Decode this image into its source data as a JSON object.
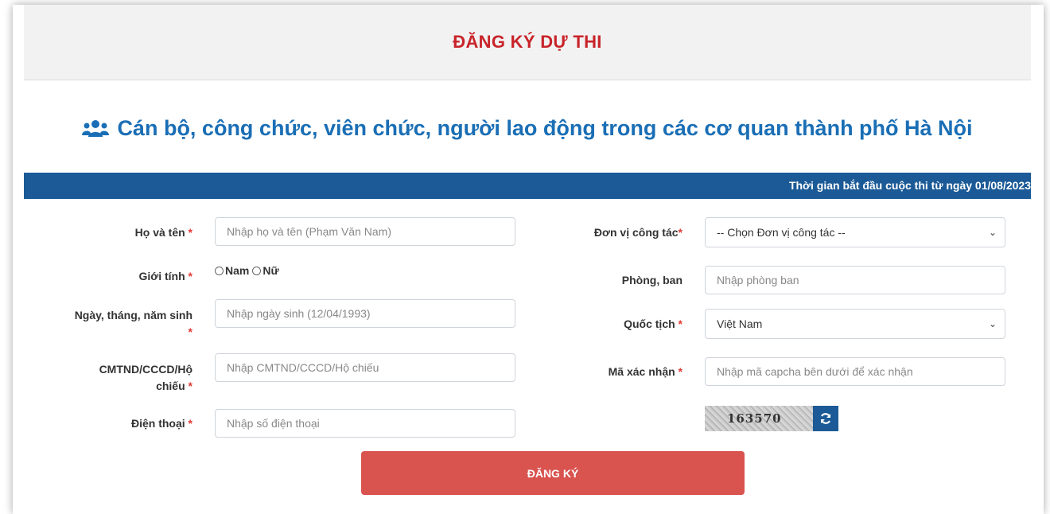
{
  "header": {
    "title": "ĐĂNG KÝ DỰ THI"
  },
  "subtitle": {
    "text": "Cán bộ, công chức, viên chức, người lao động trong các cơ quan thành phố Hà Nội",
    "icon": "users-icon"
  },
  "banner": {
    "text": "Thời gian bắt đầu cuộc thi từ ngày 01/08/2023"
  },
  "left": {
    "name": {
      "label": "Họ và tên",
      "placeholder": "Nhập họ và tên (Phạm Văn Nam)"
    },
    "gender": {
      "label": "Giới tính",
      "options": [
        "Nam",
        "Nữ"
      ]
    },
    "dob": {
      "label": "Ngày, tháng, năm sinh",
      "placeholder": "Nhập ngày sinh (12/04/1993)"
    },
    "id": {
      "label_line1": "CMTND/CCCD/Hộ",
      "label_line2": "chiếu",
      "placeholder": "Nhập CMTND/CCCD/Hộ chiếu"
    },
    "phone": {
      "label": "Điện thoại",
      "placeholder": "Nhập số điện thoại"
    }
  },
  "right": {
    "unit": {
      "label": "Đơn vị công tác",
      "value": "-- Chọn Đơn vị công tác --"
    },
    "dept": {
      "label": "Phòng, ban",
      "placeholder": "Nhập phòng ban"
    },
    "nationality": {
      "label": "Quốc tịch",
      "value": "Việt Nam"
    },
    "captcha": {
      "label": "Mã xác nhận",
      "placeholder": "Nhập mã capcha bên dưới để xác nhận",
      "code": "163570"
    }
  },
  "required_mark": "*",
  "submit_label": "ĐĂNG KÝ",
  "colors": {
    "title_red": "#c8242a",
    "brand_blue": "#1b5a96",
    "subtitle_blue": "#1a6eb5",
    "button_red": "#d9534f"
  }
}
